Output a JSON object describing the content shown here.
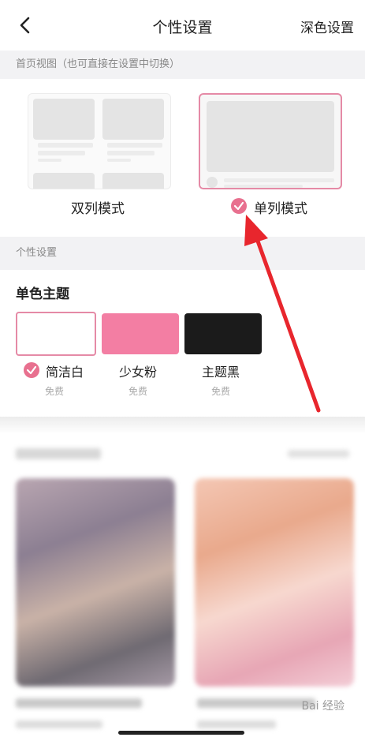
{
  "header": {
    "title": "个性设置",
    "dark_mode_link": "深色设置"
  },
  "home_view": {
    "section_label": "首页视图（也可直接在设置中切换）",
    "options": [
      {
        "label": "双列模式",
        "selected": false
      },
      {
        "label": "单列模式",
        "selected": true
      }
    ]
  },
  "personal": {
    "section_label": "个性设置",
    "theme_title": "单色主题",
    "themes": [
      {
        "name": "简洁白",
        "price": "免费",
        "color": "#ffffff",
        "selected": true
      },
      {
        "name": "少女粉",
        "price": "免费",
        "color": "#f37ea3",
        "selected": false
      },
      {
        "name": "主题黑",
        "price": "免费",
        "color": "#1b1b1b",
        "selected": false
      }
    ]
  },
  "colors": {
    "accent": "#e8708f",
    "annotation_arrow": "#e8262d"
  },
  "watermark": "Bai 经验"
}
